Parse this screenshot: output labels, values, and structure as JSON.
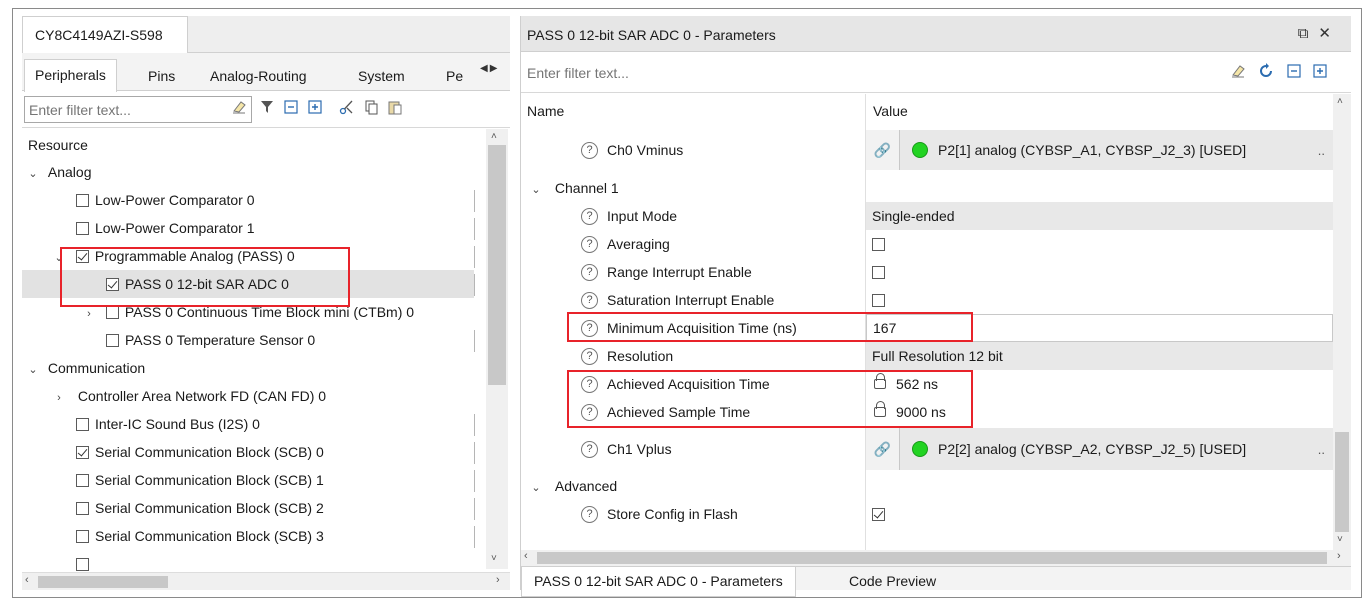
{
  "device": {
    "tab_label": "CY8C4149AZI-S598"
  },
  "left_tabs": [
    {
      "label": "Peripherals"
    },
    {
      "label": "Pins"
    },
    {
      "label": "Analog-Routing"
    },
    {
      "label": "System"
    },
    {
      "label": "Pe"
    }
  ],
  "left_filter": {
    "placeholder": "Enter filter text..."
  },
  "tree": {
    "header": "Resource",
    "rows": [
      {
        "label": "Analog"
      },
      {
        "label": "Low-Power Comparator 0"
      },
      {
        "label": "Low-Power Comparator 1"
      },
      {
        "label": "Programmable Analog (PASS) 0"
      },
      {
        "label": "PASS 0 12-bit SAR ADC 0"
      },
      {
        "label": "PASS 0 Continuous Time Block mini (CTBm) 0"
      },
      {
        "label": "PASS 0 Temperature Sensor 0"
      },
      {
        "label": "Communication"
      },
      {
        "label": "Controller Area Network FD (CAN FD) 0"
      },
      {
        "label": "Inter-IC Sound Bus (I2S) 0"
      },
      {
        "label": "Serial Communication Block (SCB) 0"
      },
      {
        "label": "Serial Communication Block (SCB) 1"
      },
      {
        "label": "Serial Communication Block (SCB) 2"
      },
      {
        "label": "Serial Communication Block (SCB) 3"
      }
    ]
  },
  "right": {
    "title": "PASS 0 12-bit SAR ADC 0 - Parameters",
    "filter_placeholder": "Enter filter text...",
    "col_name": "Name",
    "col_value": "Value",
    "rows": {
      "ch0_vminus": {
        "name": "Ch0 Vminus",
        "value": "P2[1] analog (CYBSP_A1, CYBSP_J2_3) [USED]"
      },
      "channel1": {
        "name": "Channel 1"
      },
      "input_mode": {
        "name": "Input Mode",
        "value": "Single-ended"
      },
      "averaging": {
        "name": "Averaging"
      },
      "range_int": {
        "name": "Range Interrupt Enable"
      },
      "sat_int": {
        "name": "Saturation Interrupt Enable"
      },
      "min_acq": {
        "name": "Minimum Acquisition Time (ns)",
        "value": "167"
      },
      "resolution": {
        "name": "Resolution",
        "value": "Full Resolution 12 bit"
      },
      "ach_acq": {
        "name": "Achieved Acquisition Time",
        "value": "562 ns"
      },
      "ach_sample": {
        "name": "Achieved Sample Time",
        "value": "9000 ns"
      },
      "ch1_vplus": {
        "name": "Ch1 Vplus",
        "value": "P2[2] analog (CYBSP_A2, CYBSP_J2_5) [USED]"
      },
      "advanced": {
        "name": "Advanced"
      },
      "store_cfg": {
        "name": "Store Config in Flash"
      }
    },
    "bottom_tabs": [
      {
        "label": "PASS 0 12-bit SAR ADC 0 - Parameters"
      },
      {
        "label": "Code Preview"
      }
    ]
  },
  "glyphs": {
    "help": "?",
    "ellipsis": "..",
    "link": "🔗"
  },
  "colors": {
    "highlight": "#e8232a",
    "status_used": "#22d322"
  }
}
